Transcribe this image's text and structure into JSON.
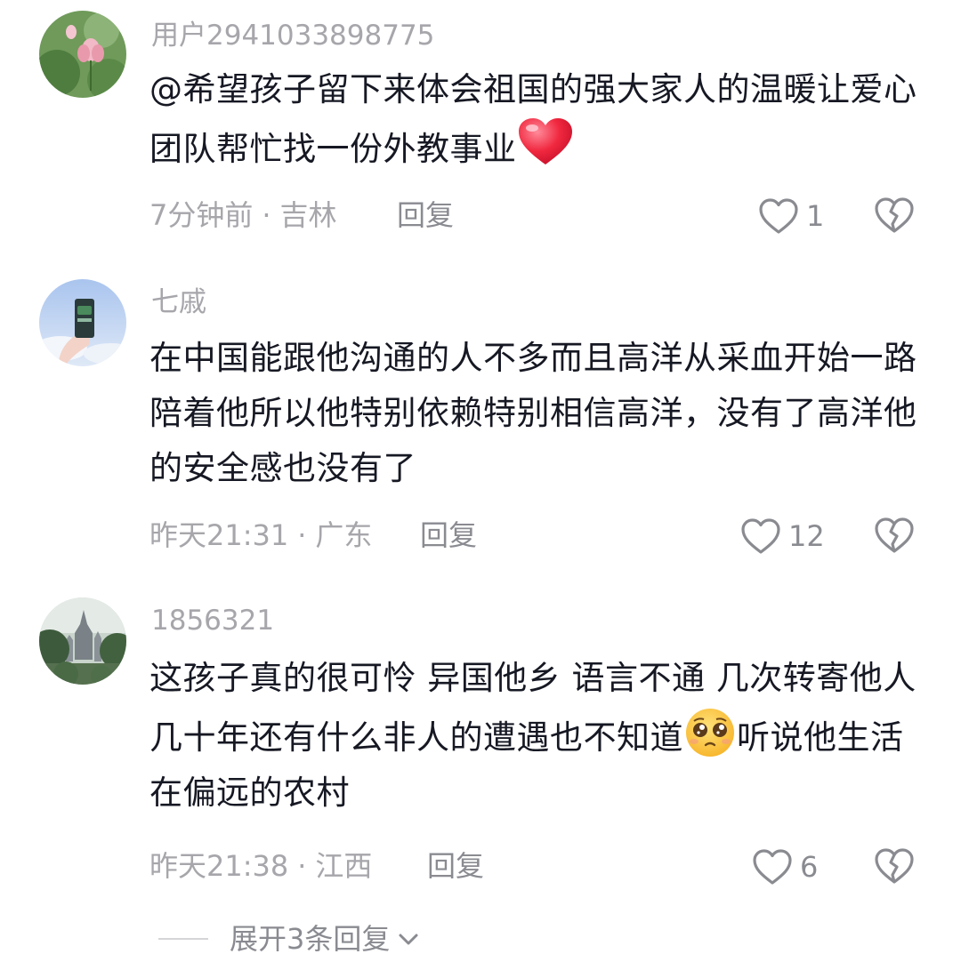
{
  "comments": [
    {
      "username": "用户2941033898775",
      "text": "@希望孩子留下来体会祖国的强大家人的温暖让爱心团队帮忙找一份外教事业",
      "emoji": "red-heart",
      "time": "7分钟前",
      "location": "吉林",
      "reply_label": "回复",
      "likes": "1"
    },
    {
      "username": "七戚",
      "text": "在中国能跟他沟通的人不多而且高洋从采血开始一路陪着他所以他特别依赖特别相信高洋，没有了高洋他的安全感也没有了",
      "time": "昨天21:31",
      "location": "广东",
      "reply_label": "回复",
      "likes": "12"
    },
    {
      "username": "1856321",
      "text_before": "这孩子真的很可怜 异国他乡 语言不通 几次转寄他人 几十年还有什么非人的遭遇也不知道",
      "emoji": "pleading-face",
      "text_after": "听说他生活在偏远的农村",
      "time": "昨天21:38",
      "location": "江西",
      "reply_label": "回复",
      "likes": "6"
    }
  ],
  "separator": "·",
  "expand_replies": "展开3条回复",
  "colors": {
    "text": "#161823",
    "secondary": "#a6a6ab",
    "action": "#8a8b91",
    "heart_red": "#fe2c55"
  }
}
